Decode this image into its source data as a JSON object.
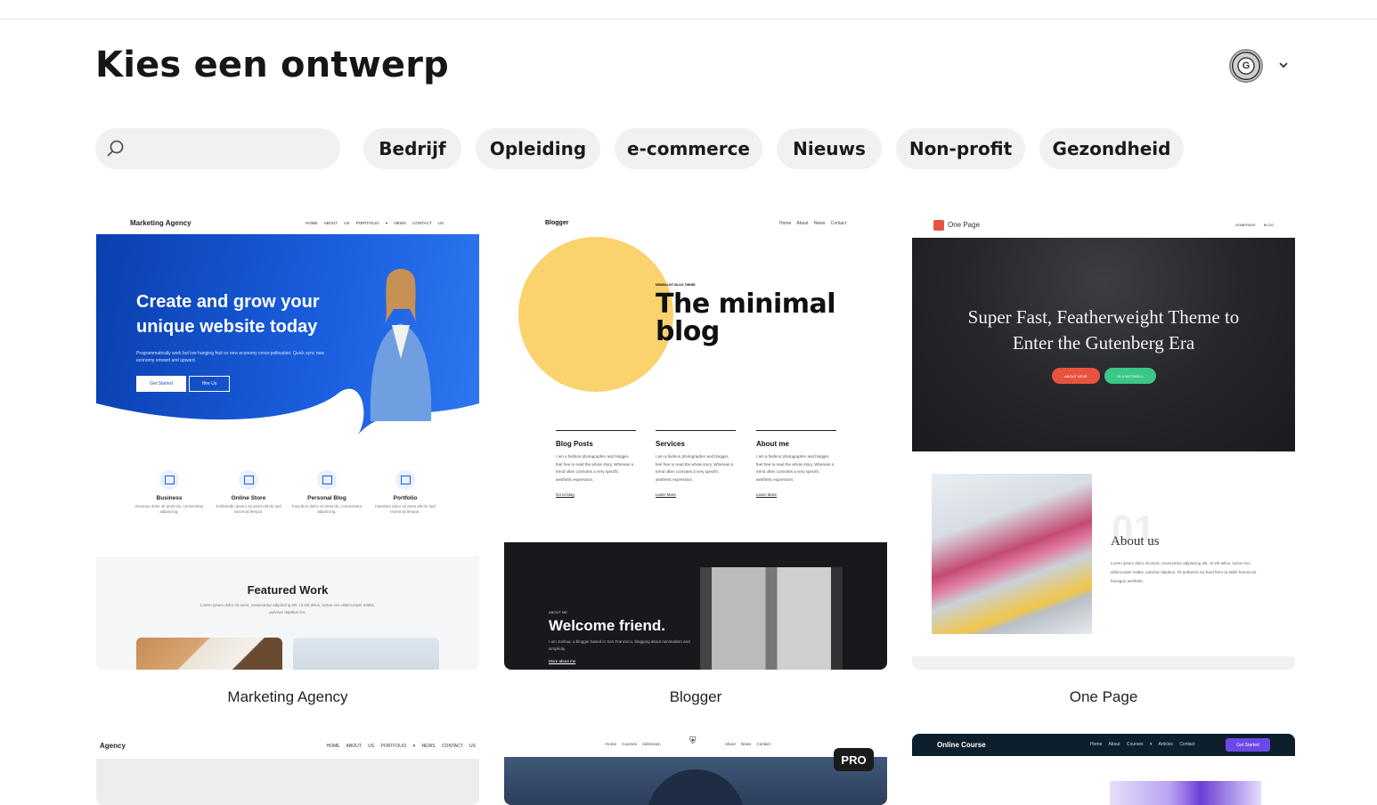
{
  "header": {
    "title": "Kies een ontwerp",
    "avatar_initial": "G"
  },
  "search": {
    "placeholder": "",
    "value": ""
  },
  "categories": [
    "Bedrijf",
    "Opleiding",
    "e-commerce",
    "Nieuws",
    "Non-profit",
    "Gezondheid"
  ],
  "templates": [
    {
      "name": "Marketing Agency",
      "preview": {
        "logo": "Marketing Agency",
        "menu": "HOME ABOUT US PORTFOLIO ▾ NEWS CONTACT US",
        "headline_1": "Create and grow your",
        "headline_2": "unique website today",
        "subtext": "Programmatically work but low hanging fruit so new economy cross-pollination. Quick sync new economy onward and upward.",
        "btn_primary": "Get Started",
        "btn_secondary": "Hire Us",
        "features": [
          {
            "title": "Business",
            "desc": "Vivamus dolor sit amet do, consectetur adipiscing."
          },
          {
            "title": "Online Store",
            "desc": "Sollicitudin ipsum sit amet elit do sed eiusmod tempor."
          },
          {
            "title": "Personal Blog",
            "desc": "Faucibus dolor sit amet do, consectetur adipiscing."
          },
          {
            "title": "Portfolio",
            "desc": "Interdum dolor sit amet elit do sed eiusmod tempor."
          }
        ],
        "featured_title": "Featured Work",
        "featured_desc": "Lorem ipsum dolor sit amet, consectetur adipiscing elit. Ut elit tellus, luctus nec ullamcorper mattis, pulvinar dapibus leo."
      }
    },
    {
      "name": "Blogger",
      "preview": {
        "logo": "Blogger",
        "menu": "Home About News Contact",
        "kicker": "MINIMALIST BLOG THEME",
        "title_1": "The minimal",
        "title_2": "blog",
        "columns": [
          {
            "heading": "Blog Posts",
            "text": "I am a fashion photographer and blogger, feel free to read the whole story. Whereas a trend often connotes a very specific aesthetic expression.",
            "link": "Go to blog"
          },
          {
            "heading": "Services",
            "text": "I am a fashion photographer and blogger, feel free to read the whole story. Whereas a trend often connotes a very specific aesthetic expression.",
            "link": "Learn More"
          },
          {
            "heading": "About me",
            "text": "I am a fashion photographer and blogger, feel free to read the whole story. Whereas a trend often connotes a very specific aesthetic expression.",
            "link": "Learn More"
          }
        ],
        "dark_kicker": "ABOUT ME",
        "dark_title": "Welcome friend.",
        "dark_desc": "I am Joshua, a blogger based in San Francisco, blogging about minimalism and simplicity.",
        "dark_link": "More about me"
      }
    },
    {
      "name": "One Page",
      "preview": {
        "logo": "One Page",
        "menu": "HOMEPAGE BLOG",
        "headline_1": "Super Fast, Featherweight Theme to",
        "headline_2": "Enter the Gutenberg Era",
        "btn_1": "ABOUT NEVE",
        "btn_2": "IN A NUTSHELL",
        "number": "01",
        "about_title": "About us",
        "about_desc": "Lorem ipsum dolor sit amet, consectetur adipiscing elit. Ut elit tellus, luctus nec ullamcorper mattis, pulvinar dapibus. Fit authentic try-hard farm-to-table hammock hexagon aesthetic."
      }
    }
  ],
  "bottom_row": {
    "agency": {
      "logo": "Agency",
      "menu": "HOME ABOUT US PORTFOLIO ▾ NEWS CONTACT US"
    },
    "university": {
      "menu_left": "Home Courses Admission",
      "seal": "University",
      "menu_right": "About News Contact",
      "badge": "PRO"
    },
    "online_course": {
      "logo": "Online Course",
      "menu": "Home About Courses ▾ Articles Contact",
      "cta": "Get Started"
    }
  },
  "colors": {
    "chip_bg": "#f1f1f1",
    "agency_blue": "#1b5fe0",
    "blogger_yellow": "#fad26e",
    "onepage_red": "#e8533f",
    "onepage_green": "#3cc787",
    "course_purple": "#6b49e6"
  }
}
